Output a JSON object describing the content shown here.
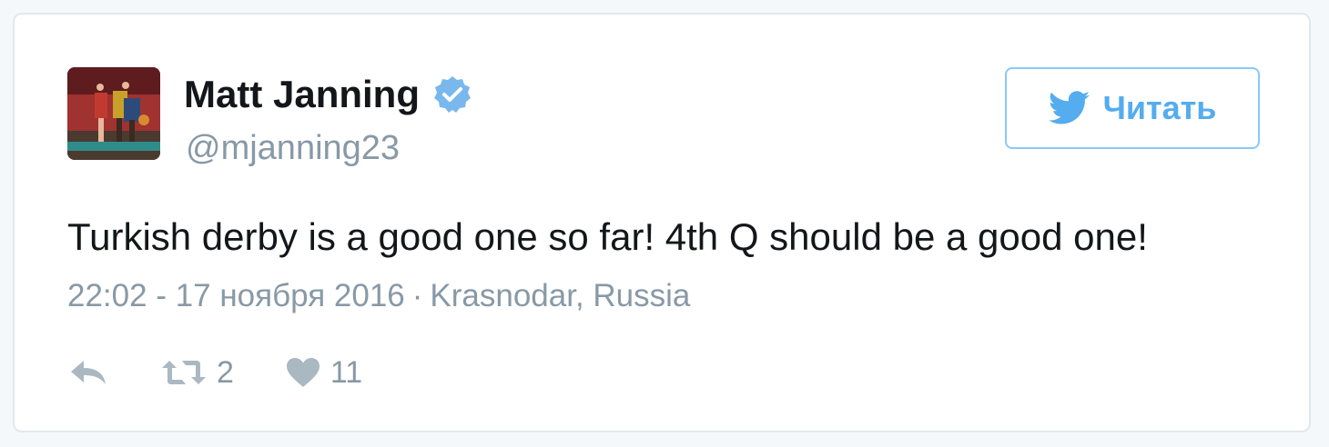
{
  "tweet": {
    "author": {
      "name": "Matt Janning",
      "handle": "@mjanning23",
      "verified": true,
      "avatar": "player-photo"
    },
    "follow_button": {
      "label": "Читать",
      "icon": "twitter-bird-icon"
    },
    "text": "Turkish derby is a good one so far! 4th Q should be a good one!",
    "timestamp": "22:02 - 17 ноября 2016",
    "separator": "·",
    "location": "Krasnodar, Russia",
    "actions": {
      "reply": {
        "icon": "reply-icon"
      },
      "retweet": {
        "icon": "retweet-icon",
        "count": "2"
      },
      "like": {
        "icon": "heart-icon",
        "count": "11"
      }
    }
  },
  "colors": {
    "text": "#14171a",
    "secondary": "#8899a6",
    "accent": "#55acee",
    "verified": "#79b8ed",
    "border": "#e1e8ed",
    "icon": "#aab8c2"
  }
}
